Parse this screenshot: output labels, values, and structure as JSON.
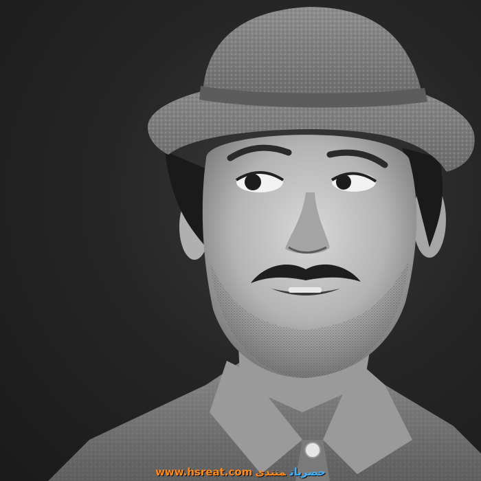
{
  "photo": {
    "subject": "man-portrait",
    "style": "black-and-white"
  },
  "watermark": {
    "url": "www.hsreat.com",
    "arabic_word_1": "حصريات",
    "arabic_word_2": "منتدى",
    "colors": {
      "url": "#ff8a1c",
      "arabic_word_1": "#3db3ff",
      "arabic_word_2": "#ff8a1c"
    }
  }
}
